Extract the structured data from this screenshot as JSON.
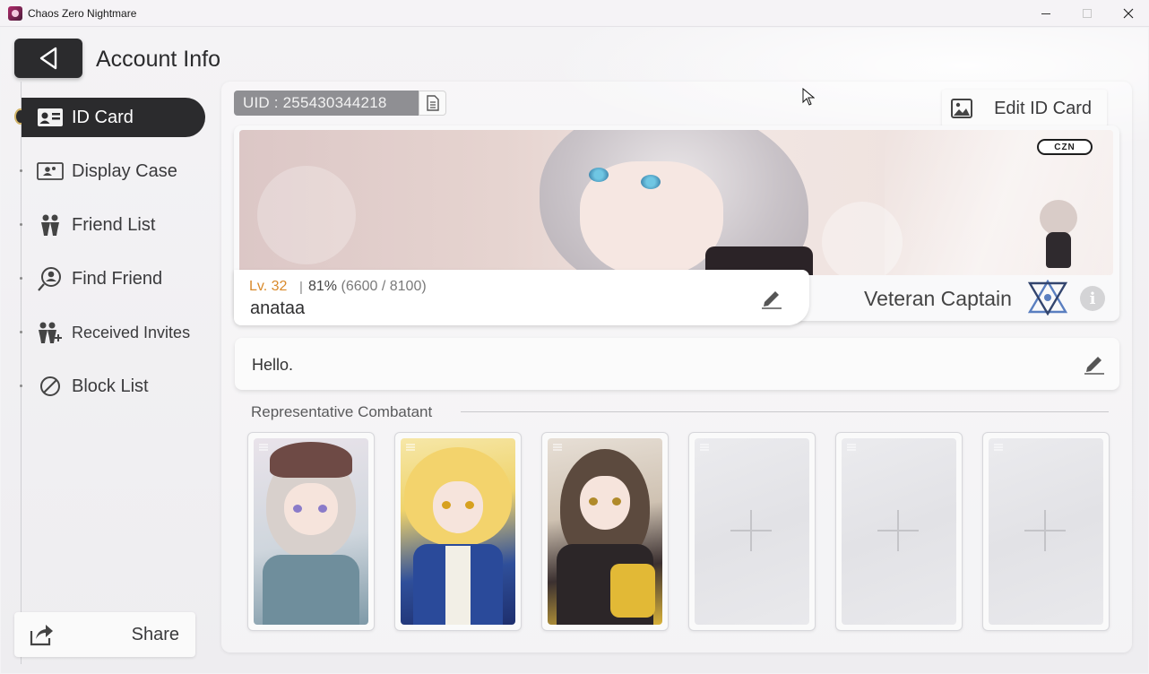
{
  "window": {
    "title": "Chaos Zero Nightmare",
    "controls": [
      "minimize",
      "maximize",
      "close"
    ]
  },
  "header": {
    "back_icon": "back-arrow-icon",
    "title": "Account Info"
  },
  "sidebar": {
    "items": [
      {
        "label": "ID Card",
        "icon": "id-card-icon",
        "active": true
      },
      {
        "label": "Display Case",
        "icon": "display-case-icon",
        "active": false
      },
      {
        "label": "Friend List",
        "icon": "friends-icon",
        "active": false
      },
      {
        "label": "Find Friend",
        "icon": "find-friend-icon",
        "active": false
      },
      {
        "label": "Received Invites",
        "icon": "invite-icon",
        "active": false
      },
      {
        "label": "Block List",
        "icon": "block-icon",
        "active": false
      }
    ],
    "share_label": "Share"
  },
  "profile": {
    "uid": "UID : 255430344218",
    "edit_card_label": "Edit ID Card",
    "level": "Lv. 32",
    "exp_percent": "81%",
    "exp_detail": "(6600 / 8100)",
    "username": "anataa",
    "title": "Veteran Captain",
    "banner_logo": "CZN",
    "bio": "Hello."
  },
  "combatants": {
    "label": "Representative Combatant",
    "slots": [
      {
        "filled": true,
        "name": "combatant-1"
      },
      {
        "filled": true,
        "name": "combatant-2"
      },
      {
        "filled": true,
        "name": "combatant-3"
      },
      {
        "filled": false
      },
      {
        "filled": false
      },
      {
        "filled": false
      }
    ]
  },
  "colors": {
    "accent_dark": "#2b2b2d",
    "level_orange": "#d98a2b",
    "panel_bg": "#f4f3f5"
  }
}
